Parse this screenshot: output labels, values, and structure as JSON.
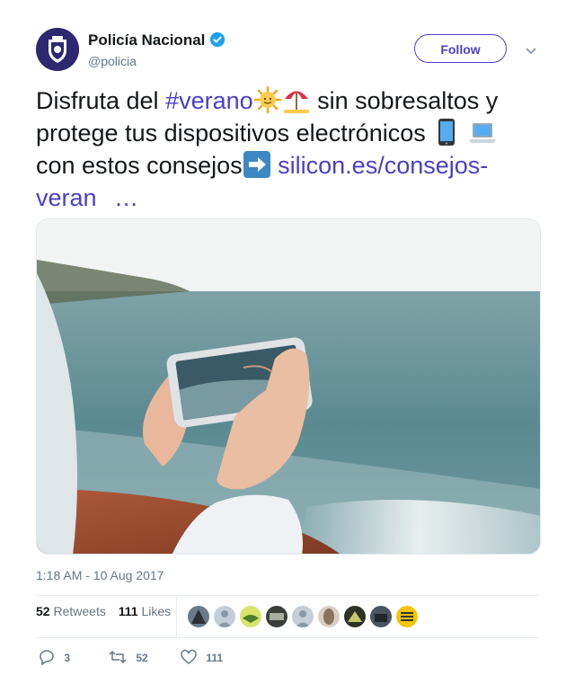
{
  "account": {
    "name": "Policía Nacional",
    "handle": "@policia",
    "verified": true,
    "avatar": "police-shield-logo"
  },
  "follow_label": "Follow",
  "tweet": {
    "text_1": "Disfruta del ",
    "hashtag": "#verano",
    "text_2": " sin sobresaltos y protege tus dispositivos electrónicos ",
    "text_3": " con estos consejos",
    "link_text": "silicon.es/consejos-veran",
    "ellipsis": "…",
    "emojis": [
      "sun-emoji",
      "beach-umbrella-emoji",
      "phone-emoji",
      "laptop-emoji",
      "right-arrow-emoji"
    ],
    "image": "hands-holding-phone-over-sea-photo"
  },
  "timestamp": "1:18 AM - 10 Aug 2017",
  "stats": {
    "retweets_count": "52",
    "retweets_label": "Retweets",
    "likes_count": "111",
    "likes_label": "Likes"
  },
  "liked_by_avatars": 9,
  "actions": {
    "replies": "3",
    "retweets": "52",
    "likes": "111"
  },
  "colors": {
    "link": "#4a3fc8",
    "verified": "#1da1f2",
    "muted": "#657786"
  }
}
